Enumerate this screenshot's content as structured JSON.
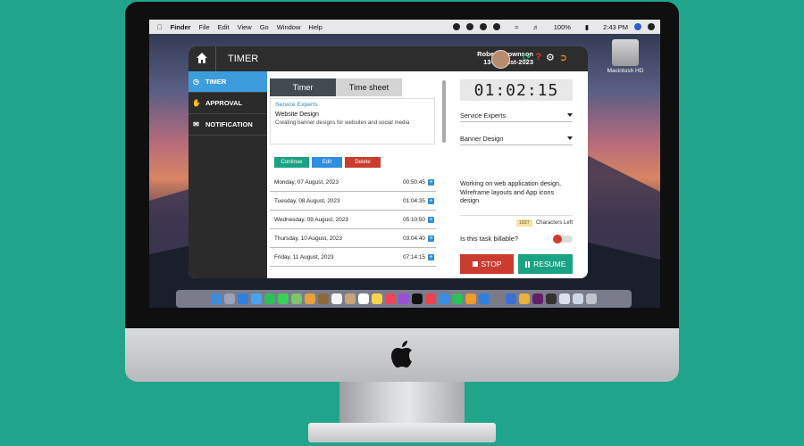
{
  "colors": {
    "background": "#21a58a",
    "accent": "#3d9ddc",
    "stop": "#c93c2f",
    "resume": "#1aa382"
  },
  "menubar": {
    "items": [
      "Finder",
      "File",
      "Edit",
      "View",
      "Go",
      "Window",
      "Help"
    ],
    "battery": "100%",
    "time": "2:43 PM"
  },
  "desktop": {
    "drive_label": "Macintosh HD"
  },
  "app": {
    "header": {
      "title": "TIMER",
      "user_name": "Robert Brownson",
      "date": "13-August-2023",
      "icons": [
        "refresh-icon",
        "help-icon",
        "gear-icon",
        "logout-icon"
      ]
    },
    "sidebar": {
      "items": [
        {
          "label": "TIMER",
          "icon": "clock-icon",
          "active": true
        },
        {
          "label": "APPROVAL",
          "icon": "thumbs-up-icon"
        },
        {
          "label": "NOTIFICATION",
          "icon": "bell-icon"
        }
      ]
    },
    "tabs": [
      "Timer",
      "Time sheet"
    ],
    "task": {
      "category": "Service Experts",
      "project": "Website Design",
      "description": "Creating banner designs for websites and social media"
    },
    "actions": {
      "continue": "Continue",
      "edit": "Edit",
      "delete": "Delete"
    },
    "entries": [
      {
        "date": "Monday, 07 August, 2023",
        "duration": "00:50:45"
      },
      {
        "date": "Tuesday, 08 August, 2023",
        "duration": "01:04:35"
      },
      {
        "date": "Wednesday, 09 August, 2023",
        "duration": "05:10:50"
      },
      {
        "date": "Thursday, 10 August, 2023",
        "duration": "03:04:40"
      },
      {
        "date": "Friday, 11 August, 2023",
        "duration": "07:14:15"
      }
    ],
    "right": {
      "clock": "01:02:15",
      "client_select": "Service Experts",
      "project_select": "Banner Design",
      "notes": "Working on web application design, Wireframe layouts and App icons design",
      "char_count": "1927",
      "char_label": "Characters Left",
      "billable_label": "Is this task billable?",
      "stop_label": "STOP",
      "resume_label": "RESUME"
    }
  }
}
